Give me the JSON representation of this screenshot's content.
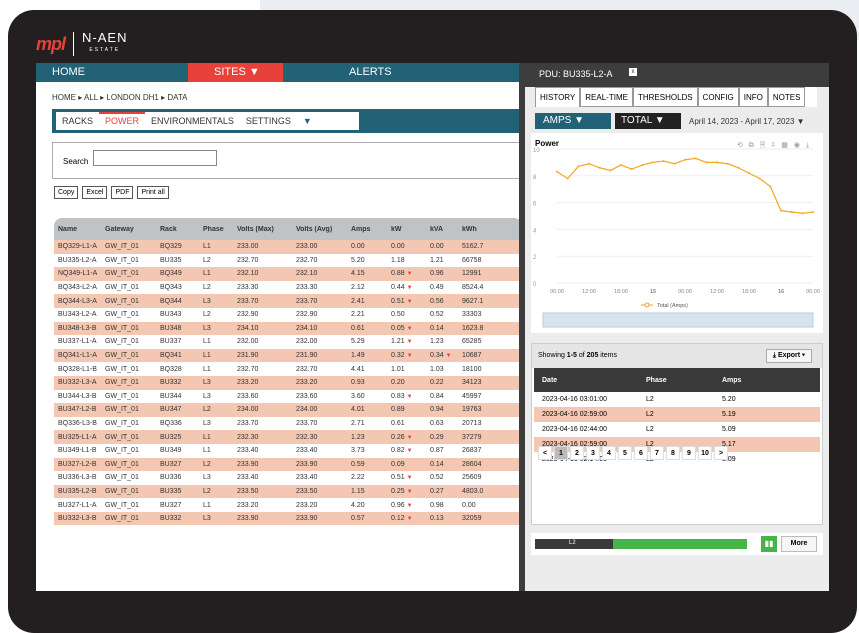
{
  "logo": {
    "brand": "mpl",
    "partner": "N-AEN",
    "partner_sub": "ESTATE"
  },
  "nav": {
    "home": "HOME",
    "sites": "SITES ▼",
    "alerts": "ALERTS"
  },
  "breadcrumb": "HOME ▸ ALL ▸ LONDON DH1 ▸ DATA",
  "subtabs": [
    "RACKS",
    "POWER",
    "ENVIRONMENTALS",
    "SETTINGS",
    "▼"
  ],
  "search": {
    "label": "Search",
    "value": ""
  },
  "export_buttons": [
    "Copy",
    "Excel",
    "PDF",
    "Print all"
  ],
  "table": {
    "headers": [
      "Name",
      "Gateway",
      "Rack",
      "Phase",
      "Volts (Max)",
      "Volts (Avg)",
      "Amps",
      "kW",
      "kVA",
      "kWh"
    ],
    "rows": [
      [
        "BQ329-L1-A",
        "GW_IT_01",
        "BQ329",
        "L1",
        "233.00",
        "233.00",
        "0.00",
        "0.00",
        "0.00",
        "5162.7"
      ],
      [
        "BU335-L2-A",
        "GW_IT_01",
        "BU335",
        "L2",
        "232.70",
        "232.70",
        "5.20",
        "1.18",
        "1.21",
        "66758"
      ],
      [
        "NQ349-L1-A",
        "GW_IT_01",
        "BQ349",
        "L1",
        "232.10",
        "232.10",
        "4.15",
        "0.88 ▼",
        "0.96",
        "12991"
      ],
      [
        "BQ343-L2-A",
        "GW_IT_01",
        "BQ343",
        "L2",
        "233.30",
        "233.30",
        "2.12",
        "0.44 ▼",
        "0.49",
        "8524.4"
      ],
      [
        "BQ344-L3-A",
        "GW_IT_01",
        "BQ344",
        "L3",
        "233.70",
        "233.70",
        "2.41",
        "0.51 ▼",
        "0.56",
        "9627.1"
      ],
      [
        "BU343-L2-A",
        "GW_IT_01",
        "BU343",
        "L2",
        "232.90",
        "232.90",
        "2.21",
        "0.50",
        "0.52",
        "33303"
      ],
      [
        "BU348-L3-B",
        "GW_IT_01",
        "BU348",
        "L3",
        "234.10",
        "234.10",
        "0.61",
        "0.05 ▼",
        "0.14",
        "1623.8"
      ],
      [
        "BU337-L1-A",
        "GW_IT_01",
        "BU337",
        "L1",
        "232.00",
        "232.00",
        "5.29",
        "1.21 ▼",
        "1.23",
        "65285"
      ],
      [
        "BQ341-L1-A",
        "GW_IT_01",
        "BQ341",
        "L1",
        "231.90",
        "231.90",
        "1.49",
        "0.32 ▼",
        "0.34 ▼",
        "10687"
      ],
      [
        "BQ328-L1-B",
        "GW_IT_01",
        "BQ328",
        "L1",
        "232.70",
        "232.70",
        "4.41",
        "1.01",
        "1.03",
        "18100"
      ],
      [
        "BU332-L3-A",
        "GW_IT_01",
        "BU332",
        "L3",
        "233.20",
        "233.20",
        "0.93",
        "0.20",
        "0.22",
        "34123"
      ],
      [
        "BU344-L3-B",
        "GW_IT_01",
        "BU344",
        "L3",
        "233.60",
        "233.60",
        "3.60",
        "0.83 ▼",
        "0.84",
        "45997"
      ],
      [
        "BU347-L2-B",
        "GW_IT_01",
        "BU347",
        "L2",
        "234.00",
        "234.00",
        "4.01",
        "0.89",
        "0.94",
        "19763"
      ],
      [
        "BQ336-L3-B",
        "GW_IT_01",
        "BQ336",
        "L3",
        "233.70",
        "233.70",
        "2.71",
        "0.61",
        "0.63",
        "20713"
      ],
      [
        "BU325-L1-A",
        "GW_IT_01",
        "BU325",
        "L1",
        "232.30",
        "232.30",
        "1.23",
        "0.26 ▼",
        "0.29",
        "37279"
      ],
      [
        "BU349-L1-B",
        "GW_IT_01",
        "BU349",
        "L1",
        "233.40",
        "233.40",
        "3.73",
        "0.82 ▼",
        "0.87",
        "26837"
      ],
      [
        "BU327-L2-B",
        "GW_IT_01",
        "BU327",
        "L2",
        "233.90",
        "233.90",
        "0.59",
        "0.09",
        "0.14",
        "28604"
      ],
      [
        "BU336-L3-B",
        "GW_IT_01",
        "BU336",
        "L3",
        "233.40",
        "233.40",
        "2.22",
        "0.51 ▼",
        "0.52",
        "25609"
      ],
      [
        "BU335-L2-B",
        "GW_IT_01",
        "BU335",
        "L2",
        "233.50",
        "233.50",
        "1.15",
        "0.25 ▼",
        "0.27",
        "4803.0"
      ],
      [
        "BU327-L1-A",
        "GW_IT_01",
        "BU327",
        "L1",
        "233.20",
        "233.20",
        "4.20",
        "0.96 ▼",
        "0.98",
        "0.00"
      ],
      [
        "BU332-L3-B",
        "GW_IT_01",
        "BU332",
        "L3",
        "233.90",
        "233.90",
        "0.57",
        "0.12 ▼",
        "0.13",
        "32059"
      ]
    ]
  },
  "pdu": {
    "title": "PDU: BU335-L2-A",
    "close": "x",
    "tabs": [
      "HISTORY",
      "REAL-TIME",
      "THRESHOLDS",
      "CONFIG",
      "INFO",
      "NOTES"
    ],
    "metric": "AMPS ▼",
    "scope": "TOTAL ▼",
    "date_range": "April 14, 2023 - April 17, 2023 ▼",
    "chart_title": "Power",
    "tools": "⟲ ⧉ 🗎 ⍏ ▦ ◉ ⤓",
    "showing": {
      "prefix": "Showing ",
      "range": "1-5",
      "mid": " of ",
      "total": "205",
      "suffix": " items"
    },
    "export": "⤓ Export ▾",
    "grid_headers": [
      "Date",
      "Phase",
      "Amps"
    ],
    "grid_rows": [
      [
        "2023-04-16 03:01:00",
        "L2",
        "5.20"
      ],
      [
        "2023-04-16 02:59:00",
        "L2",
        "5.19"
      ],
      [
        "2023-04-16 02:44:00",
        "L2",
        "5.09"
      ],
      [
        "2023-04-16 02:59:00",
        "L2",
        "5.17"
      ],
      [
        "2023-04-16 02:14:00",
        "L2",
        "5.09"
      ]
    ],
    "pages": [
      "<",
      "1",
      "2",
      "3",
      "4",
      "5",
      "6",
      "7",
      "8",
      "9",
      "10",
      ">"
    ],
    "status_phase": "L2",
    "status_level": 0.63,
    "more": "More"
  },
  "chart_data": {
    "type": "line",
    "title": "Power",
    "ylim": [
      0,
      10
    ],
    "yticks": [
      "0",
      "2",
      "4",
      "6",
      "8",
      "10"
    ],
    "xticks": [
      "06:00",
      "12:00",
      "18:00",
      "15",
      "06:00",
      "12:00",
      "18:00",
      "16",
      "06:00"
    ],
    "series": [
      {
        "name": "Total (Amps)",
        "color": "#f5a623",
        "x": [
          0,
          1,
          2,
          3,
          4,
          5,
          6,
          7,
          8,
          9,
          10,
          11,
          12,
          13,
          14,
          15,
          16,
          17,
          18,
          19,
          20,
          21,
          22,
          23,
          24
        ],
        "values": [
          8.3,
          7.8,
          8.7,
          8.9,
          8.6,
          8.4,
          8.8,
          8.5,
          8.8,
          9.0,
          9.1,
          8.9,
          9.2,
          9.3,
          9.0,
          9.0,
          8.9,
          8.6,
          8.2,
          7.8,
          7.2,
          5.4,
          5.3,
          5.2,
          5.3
        ]
      }
    ],
    "grid": true
  }
}
